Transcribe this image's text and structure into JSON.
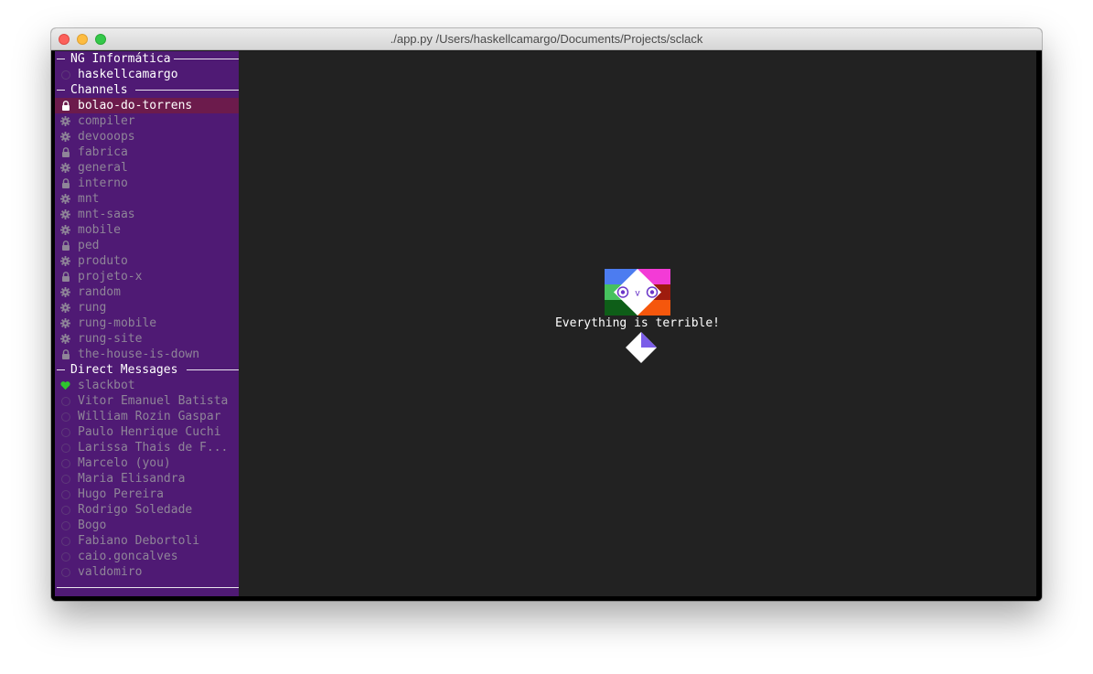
{
  "window": {
    "title": "./app.py  /Users/haskellcamargo/Documents/Projects/sclack"
  },
  "workspace": {
    "name": "NG Informática",
    "user": "haskellcamargo"
  },
  "channels_section": {
    "title": "Channels",
    "items": [
      {
        "label": "bolao-do-torrens",
        "icon": "lock-icon",
        "selected": true
      },
      {
        "label": "compiler",
        "icon": "gear-icon"
      },
      {
        "label": "devooops",
        "icon": "gear-icon"
      },
      {
        "label": "fabrica",
        "icon": "lock-icon"
      },
      {
        "label": "general",
        "icon": "gear-icon"
      },
      {
        "label": "interno",
        "icon": "lock-icon"
      },
      {
        "label": "mnt",
        "icon": "gear-icon"
      },
      {
        "label": "mnt-saas",
        "icon": "gear-icon"
      },
      {
        "label": "mobile",
        "icon": "gear-icon"
      },
      {
        "label": "ped",
        "icon": "lock-icon"
      },
      {
        "label": "produto",
        "icon": "gear-icon"
      },
      {
        "label": "projeto-x",
        "icon": "lock-icon"
      },
      {
        "label": "random",
        "icon": "gear-icon"
      },
      {
        "label": "rung",
        "icon": "gear-icon"
      },
      {
        "label": "rung-mobile",
        "icon": "gear-icon"
      },
      {
        "label": "rung-site",
        "icon": "gear-icon"
      },
      {
        "label": "the-house-is-down",
        "icon": "lock-icon"
      }
    ]
  },
  "dm_section": {
    "title": "Direct Messages",
    "items": [
      {
        "label": "slackbot",
        "icon": "heart-icon"
      },
      {
        "label": "Vitor Emanuel Batista",
        "icon": "presence-circle-icon"
      },
      {
        "label": "William Rozin Gaspar",
        "icon": "presence-circle-icon"
      },
      {
        "label": "Paulo Henrique Cuchi",
        "icon": "presence-circle-icon"
      },
      {
        "label": "Larissa Thais de F...",
        "icon": "presence-circle-icon"
      },
      {
        "label": "Marcelo (you)",
        "icon": "presence-circle-icon"
      },
      {
        "label": "Maria Elisandra",
        "icon": "presence-circle-icon"
      },
      {
        "label": "Hugo Pereira",
        "icon": "presence-circle-icon"
      },
      {
        "label": "Rodrigo Soledade",
        "icon": "presence-circle-icon"
      },
      {
        "label": "Bogo",
        "icon": "presence-circle-icon"
      },
      {
        "label": "Fabiano Debortoli",
        "icon": "presence-circle-icon"
      },
      {
        "label": "caio.goncalves",
        "icon": "presence-circle-icon"
      },
      {
        "label": "valdomiro",
        "icon": "presence-circle-icon"
      }
    ]
  },
  "main": {
    "tagline": "Everything is terrible!",
    "logo_icon": "sclack-logo-icon",
    "loader_icon": "diamond-loader-icon"
  },
  "colors": {
    "sidebar_bg": "#4f1a74",
    "selected_bg": "#6c1b4c",
    "main_bg": "#222222",
    "presence_online": "#2ec42e"
  }
}
